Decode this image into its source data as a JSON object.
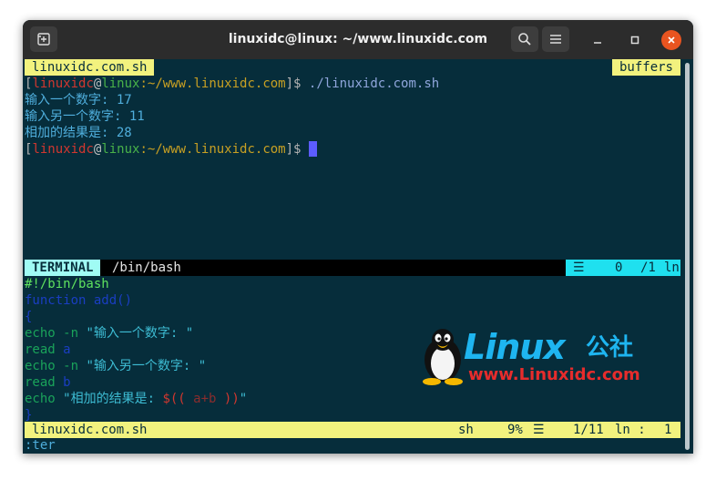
{
  "titlebar": {
    "title": "linuxidc@linux: ~/www.linuxidc.com",
    "new_tab_icon": "new-tab-icon",
    "search_icon": "search-icon",
    "menu_icon": "hamburger-menu-icon",
    "minimize_icon": "minimize-icon",
    "maximize_icon": "maximize-icon",
    "close_icon": "close-icon",
    "close_color": "#e95420"
  },
  "tabline": {
    "file_tab": "linuxidc.com.sh",
    "buffers_label": "buffers"
  },
  "terminal": {
    "prompt1": {
      "open": "[",
      "user": "linuxidc",
      "at": "@",
      "host": "linux",
      "path": ":~/www.linuxidc.com",
      "close": "]$",
      "command": " ./linuxidc.com.sh"
    },
    "output": [
      "输入一个数字: 17",
      "输入另一个数字: 11",
      "相加的结果是: 28"
    ],
    "prompt2": {
      "open": "[",
      "user": "linuxidc",
      "at": "@",
      "host": "linux",
      "path": ":~/www.linuxidc.com",
      "close": "]$ "
    }
  },
  "terminal_status": {
    "mode": "TERMINAL",
    "shell": "/bin/bash",
    "menu_icon": "☰",
    "percent": "0",
    "position": "/1",
    "ln": "ln"
  },
  "source": {
    "shebang": "#!/bin/bash",
    "function_line": "function add()",
    "open_brace": "{",
    "echo1_cmd": "echo -n ",
    "echo1_str": "\"输入一个数字: \"",
    "read_a_cmd": "read ",
    "read_a_var": "a",
    "echo2_cmd": "echo -n ",
    "echo2_str": "\"输入另一个数字: \"",
    "read_b_cmd": "read ",
    "read_b_var": "b",
    "echo3_cmd": "echo ",
    "echo3_str_open": "\"相加的结果是: ",
    "echo3_sub_open": "$(( ",
    "echo3_expr": "a+b",
    "echo3_sub_close": " ))",
    "echo3_str_close": "\"",
    "close_brace": "}"
  },
  "file_status": {
    "filename": "linuxidc.com.sh",
    "filetype": "sh",
    "percent": "9%",
    "menu_icon": "☰",
    "position": "1/11",
    "ln_label": "ln :",
    "column": "1"
  },
  "cmdline": ":ter",
  "watermark": {
    "brand": "Linux",
    "brand_cn": "公社",
    "url": "www.Linuxidc.com",
    "icon": "tux-penguin-icon"
  }
}
